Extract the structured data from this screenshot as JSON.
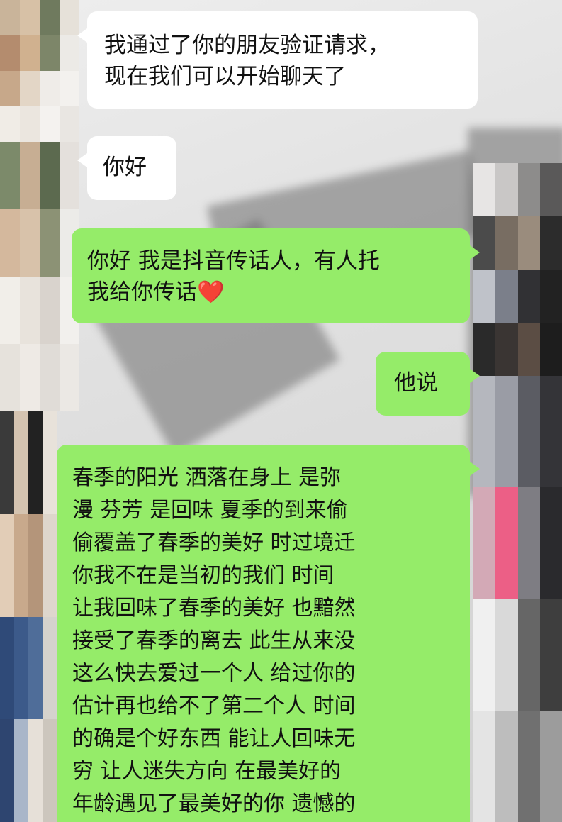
{
  "conversation": {
    "messages": [
      {
        "direction": "incoming",
        "lines": [
          "我通过了你的朋友验证请求，",
          "现在我们可以开始聊天了"
        ]
      },
      {
        "direction": "incoming",
        "lines": [
          "你好"
        ]
      },
      {
        "direction": "outgoing",
        "lines": [
          "你好 我是抖音传话人，有人托",
          "我给你传话"
        ],
        "emoji": "❤️"
      },
      {
        "direction": "outgoing",
        "lines": [
          "他说"
        ]
      },
      {
        "direction": "outgoing",
        "lines": [
          "春季的阳光  洒落在身上  是弥",
          "漫  芬芳  是回味  夏季的到来偷",
          "偷覆盖了春季的美好  时过境迁",
          " 你我不在是当初的我们   时间",
          "让我回味了春季的美好  也黯然",
          "接受了春季的离去  此生从来没",
          "这么快去爱过一个人 给过你的",
          "估计再也给不了第二个人  时间",
          "的确是个好东西  能让人回味无",
          "穷  让人迷失方向  在最美好的",
          "年龄遇见了最美好的你 遗憾的"
        ]
      }
    ]
  },
  "colors": {
    "outgoing_bubble": "#95ec69",
    "incoming_bubble": "#ffffff",
    "text": "#111111"
  },
  "avatars": {
    "left": "pixelated-avatar-icon",
    "right": "pixelated-avatar-icon"
  }
}
